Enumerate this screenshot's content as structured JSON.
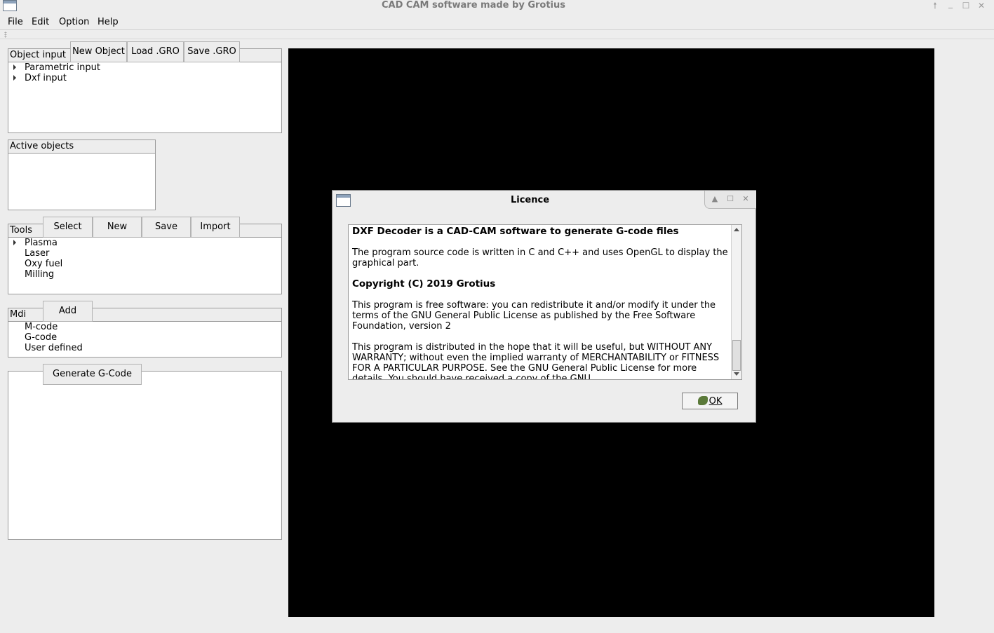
{
  "window": {
    "title": "CAD CAM software made by Grotius",
    "controls": {
      "up": "🠕",
      "minimize": "_",
      "maximize": "☐",
      "close": "✕"
    }
  },
  "menu": [
    "File",
    "Edit",
    "Option",
    "Help"
  ],
  "object_input": {
    "label": "Object input",
    "buttons": [
      "New Object",
      "Load .GRO",
      "Save .GRO"
    ],
    "items": [
      "Parametric input",
      "Dxf input"
    ]
  },
  "active_objects": {
    "label": "Active objects"
  },
  "tools": {
    "label": "Tools",
    "buttons": [
      "Select",
      "New",
      "Save",
      "Import"
    ],
    "items": [
      "Plasma",
      "Laser",
      "Oxy fuel",
      "Milling"
    ]
  },
  "mdi": {
    "label": "Mdi",
    "add_label": "Add",
    "items": [
      "M-code",
      "G-code",
      "User defined"
    ]
  },
  "gcode": {
    "generate_label": "Generate G-Code"
  },
  "dialog": {
    "title": "Licence",
    "heading": "DXF Decoder is a CAD-CAM software to generate G-code files",
    "para1": "The program source code is written in C and C++ and uses OpenGL to display the graphical part.",
    "copyright": "Copyright (C) 2019  Grotius",
    "para2": "This program is free software: you can redistribute it and/or modify it under the terms of the GNU General Public License as published by the Free Software Foundation, version 2",
    "para3": "This program is distributed in the hope that it will be useful, but WITHOUT ANY WARRANTY; without even the implied warranty of MERCHANTABILITY or FITNESS FOR A PARTICULAR PURPOSE.  See the GNU General Public License for more details. You should have received a copy of the GNU",
    "ok_label": "OK"
  },
  "colors": {
    "viewport": "#000000",
    "background": "#ededed"
  },
  "icons": {
    "ok": "ok-check-icon",
    "app": "app-window-icon"
  }
}
